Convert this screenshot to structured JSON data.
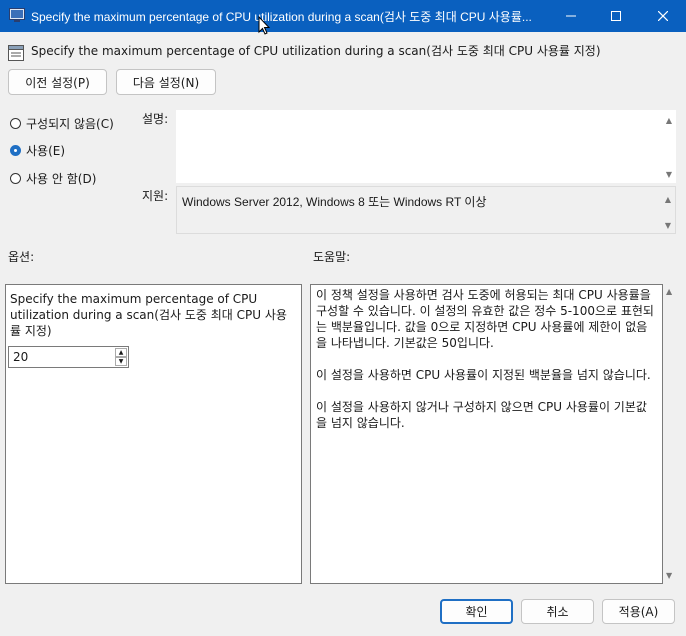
{
  "window": {
    "title": "Specify the maximum percentage of CPU utilization during a scan(검사 도중 최대 CPU 사용률..."
  },
  "header": {
    "setting_name": "Specify the maximum percentage of CPU utilization during a scan(검사 도중 최대 CPU 사용률 지정)",
    "prev_button": "이전 설정(P)",
    "next_button": "다음 설정(N)"
  },
  "state": {
    "options": [
      {
        "label": "구성되지 않음(C)",
        "checked": false
      },
      {
        "label": "사용(E)",
        "checked": true
      },
      {
        "label": "사용 안 함(D)",
        "checked": false
      }
    ]
  },
  "comment": {
    "label": "설명:",
    "value": ""
  },
  "supported": {
    "label": "지원:",
    "value": "Windows Server 2012, Windows 8 또는 Windows RT 이상"
  },
  "options_section": {
    "label": "옵션:",
    "description": "Specify the maximum percentage of CPU utilization during a scan(검사 도중 최대 CPU 사용률 지정)",
    "value": "20"
  },
  "help_section": {
    "label": "도움말:",
    "text": "이 정책 설정을 사용하면 검사 도중에 허용되는 최대 CPU 사용률을 구성할 수 있습니다. 이 설정의 유효한 값은 정수 5-100으로 표현되는 백분율입니다. 값을 0으로 지정하면 CPU 사용률에 제한이 없음을 나타냅니다. 기본값은 50입니다.\n\n이 설정을 사용하면 CPU 사용률이 지정된 백분율을 넘지 않습니다.\n\n이 설정을 사용하지 않거나 구성하지 않으면 CPU 사용률이 기본값을 넘지 않습니다."
  },
  "footer": {
    "ok": "확인",
    "cancel": "취소",
    "apply": "적용(A)"
  },
  "colors": {
    "titlebar": "#0a60bf",
    "accent": "#1f6fc4"
  }
}
